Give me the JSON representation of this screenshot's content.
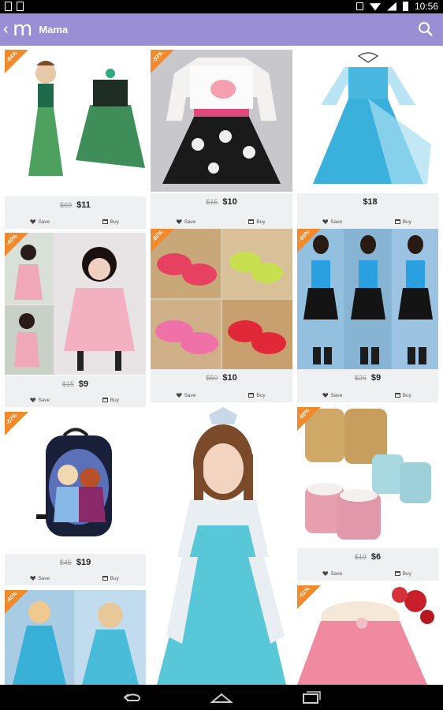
{
  "status": {
    "time": "10:56"
  },
  "app": {
    "logo": "m",
    "title": "Mama"
  },
  "labels": {
    "save": "Save",
    "buy": "Buy"
  },
  "products": [
    {
      "discount": "-84%",
      "old_price": "$69",
      "price": "$11"
    },
    {
      "discount": "-33%",
      "old_price": "$15",
      "price": "$10"
    },
    {
      "discount": "",
      "old_price": "",
      "price": "$18"
    },
    {
      "discount": "-40%",
      "old_price": "$15",
      "price": "$9"
    },
    {
      "discount": "-80%",
      "old_price": "$50",
      "price": "$10"
    },
    {
      "discount": "-65%",
      "old_price": "$26",
      "price": "$9"
    },
    {
      "discount": "-57%",
      "old_price": "$45",
      "price": "$19"
    },
    {
      "discount": "",
      "old_price": "",
      "price": ""
    },
    {
      "discount": "-68%",
      "old_price": "$19",
      "price": "$6"
    },
    {
      "discount": "-40%",
      "old_price": "",
      "price": ""
    },
    {
      "discount": "-51%",
      "old_price": "",
      "price": ""
    }
  ],
  "icons": {
    "back": "chevron-left-icon",
    "search": "search-icon",
    "save": "heart-icon",
    "buy": "cart-icon",
    "nav_back": "back-arrow-icon",
    "nav_home": "home-icon",
    "nav_recent": "recent-apps-icon"
  },
  "colors": {
    "appbar": "#9a8fd4",
    "badge": "#f08a2c",
    "info_bg": "#eef0f2"
  }
}
